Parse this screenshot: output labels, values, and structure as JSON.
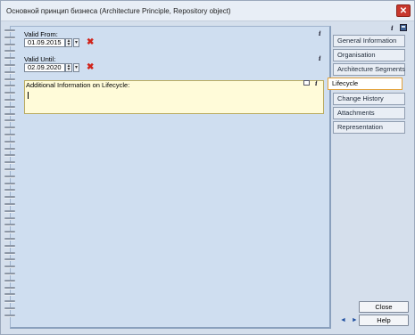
{
  "window": {
    "title": "Основной принцип бизнеса (Architecture Principle, Repository object)",
    "close_glyph": "✕"
  },
  "form": {
    "valid_from_label": "Valid From:",
    "valid_from_value": "01.09.2015",
    "valid_until_label": "Valid Until:",
    "valid_until_value": "02.09.2020",
    "additional_info_label": "Additional Information on Lifecycle:",
    "info_glyph": "i",
    "clear_glyph": "✖",
    "spin_up": "▲",
    "spin_down": "▼",
    "dropdown_glyph": "▾"
  },
  "tabs": [
    {
      "label": "General Information"
    },
    {
      "label": "Organisation"
    },
    {
      "label": "Architecture Segments"
    },
    {
      "label": "Lifecycle"
    },
    {
      "label": "Change History"
    },
    {
      "label": "Attachments"
    },
    {
      "label": "Representation"
    }
  ],
  "buttons": {
    "close": "Close",
    "help": "Help"
  },
  "nav_arrows": "◄ ►",
  "colors": {
    "active_tab_border": "#e3a23a",
    "info_box_bg": "#fffbd9",
    "clear_icon": "#d0241b"
  }
}
